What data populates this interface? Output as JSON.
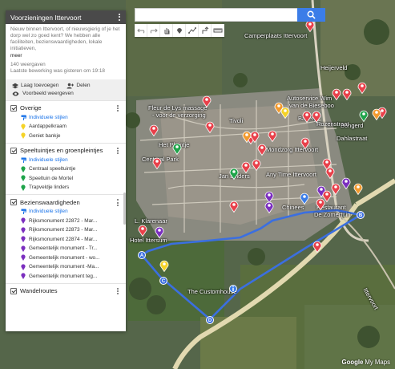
{
  "search": {
    "placeholder": "",
    "value": ""
  },
  "toolbar": {
    "buttons": [
      "undo-icon",
      "redo-icon",
      "hand-icon",
      "marker-icon",
      "draw-line-icon",
      "route-icon",
      "ruler-icon"
    ]
  },
  "panel": {
    "title": "Voorzieningen Ittervoort",
    "description": "Nieuw binnen Ittervoort, of nieuwsgierig of je het dorp wel zo goed kent? We hebben alle faciliteiten, bezienswaardigheden, lokale initiatieven,",
    "more": "meer",
    "views": "140 weergaven",
    "last_edit": "Laatste bewerking was gisteren om 19:18",
    "add_layer": "Laag toevoegen",
    "share": "Delen",
    "preview": "Voorbeeld weergeven",
    "layers": [
      {
        "title": "Overige",
        "styles": "Individuele stijlen",
        "items": [
          {
            "label": "Aardappelkraam",
            "color": "#f5d327"
          },
          {
            "label": "Geniet bankje",
            "color": "#f5d327"
          }
        ]
      },
      {
        "title": "Speeltuintjes en groenpleintjes",
        "styles": "Individuele stijlen",
        "items": [
          {
            "label": "Centraal speeltuintje",
            "color": "#1fa44a"
          },
          {
            "label": "Speeltuin de Mortel",
            "color": "#1fa44a"
          },
          {
            "label": "Trapveldje linders",
            "color": "#1fa44a"
          }
        ]
      },
      {
        "title": "Bezienswaardigheden",
        "styles": "Individuele stijlen",
        "items": [
          {
            "label": "Rijksmonument 22872 - Mar...",
            "color": "#7b2fbf"
          },
          {
            "label": "Rijksmonument 22873 - Mar...",
            "color": "#7b2fbf"
          },
          {
            "label": "Rijksmonument 22874 - Mar...",
            "color": "#7b2fbf"
          },
          {
            "label": "Gemeentelijk monument - Tr...",
            "color": "#7b2fbf"
          },
          {
            "label": "Gemeentelijk monument - wo...",
            "color": "#7b2fbf"
          },
          {
            "label": "Gemeentelijk monument -Ma...",
            "color": "#7b2fbf"
          },
          {
            "label": "Gemeentelijk monument teg...",
            "color": "#7b2fbf"
          }
        ]
      },
      {
        "title": "Wandelroutes",
        "styles": "",
        "items": []
      }
    ]
  },
  "map": {
    "labels": [
      "Camperplaats Ittervoort",
      "Fleur de Lys massage",
      "- voor de verzorging",
      "Autoservice Wim",
      "van de Bieseboo",
      "Tivoli",
      "Bakery",
      "Bongerd",
      "Dahlastraat",
      "Het Pleintje",
      "Centraal Park",
      "Mondzorg Ittervoort",
      "Jan Linders",
      "Any Time Ittervoort",
      "Chinees",
      "Restaurant",
      "De Zomertuin",
      "L. Klarenaar",
      "Hotel Ittersum",
      "The Customhouse",
      "Heijerveld",
      "Rozenstraat",
      "Ittervoort"
    ],
    "waypoints": [
      "A",
      "B",
      "C",
      "D"
    ]
  },
  "brand": {
    "google": "Google",
    "mymaps": "My Maps"
  },
  "colors": {
    "accent": "#3b7de8",
    "header": "#4a4a4a",
    "route": "#3b6fe0",
    "red": "#e8404a"
  }
}
